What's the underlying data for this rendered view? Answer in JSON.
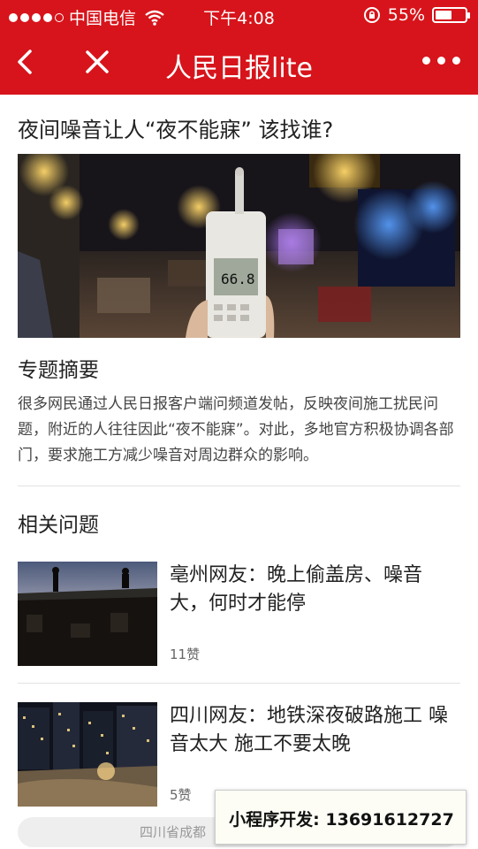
{
  "status_bar": {
    "carrier": "中国电信",
    "time": "下午4:08",
    "battery_percent": "55%",
    "battery_level": 0.55
  },
  "nav": {
    "title": "人民日报lite"
  },
  "article": {
    "title": "夜间噪音让人“夜不能寐” 该找谁?",
    "hero_meter_reading": "66.8"
  },
  "summary": {
    "heading": "专题摘要",
    "text": "很多网民通过人民日报客户端问频道发帖，反映夜间施工扰民问题，附近的人往往因此“夜不能寐”。对此，多地官方积极协调各部门，要求施工方减少噪音对周边群众的影响。"
  },
  "related": {
    "heading": "相关问题",
    "items": [
      {
        "title": "亳州网友：晚上偷盖房、噪音大，何时才能停",
        "likes": "11赞"
      },
      {
        "title": "四川网友：地铁深夜破路施工 噪音太大 施工不要太晚",
        "likes": "5赞"
      }
    ]
  },
  "footer": {
    "location_text": "四川省成都",
    "promo_text": "小程序开发: 13691612727"
  },
  "colors": {
    "brand_red": "#d7141b"
  }
}
